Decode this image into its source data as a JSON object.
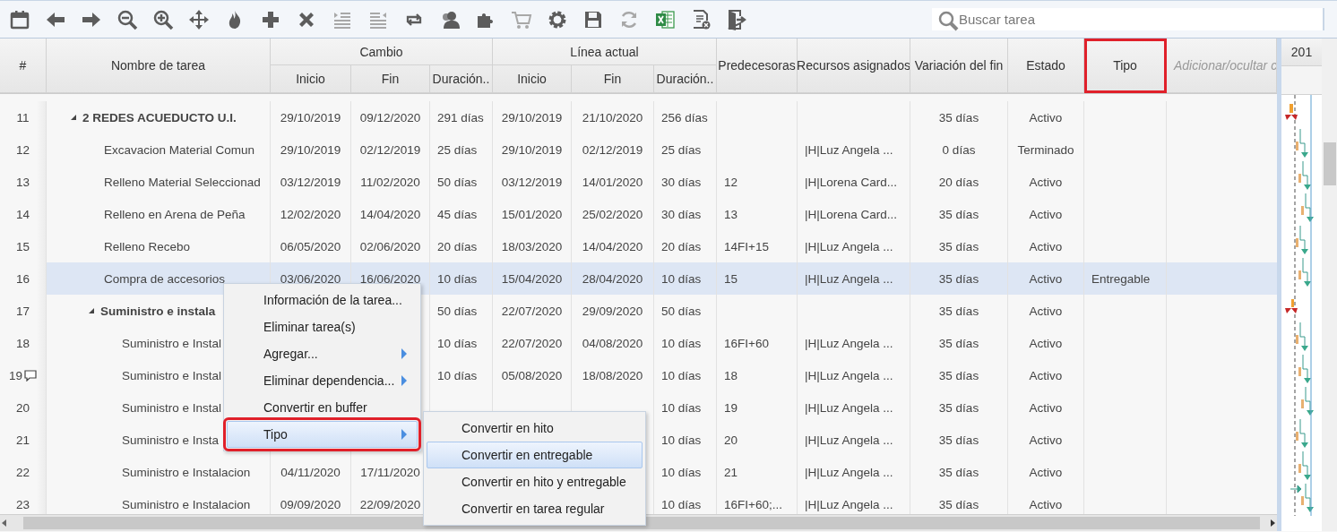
{
  "toolbar": {
    "buttons": [
      {
        "disabled": false
      },
      {
        "disabled": false
      },
      {
        "disabled": false
      },
      {
        "disabled": false
      },
      {
        "disabled": false
      },
      {
        "disabled": false
      },
      {
        "disabled": false
      },
      {
        "disabled": false
      },
      {
        "disabled": false
      },
      {
        "disabled": true
      },
      {
        "disabled": true
      },
      {
        "disabled": false
      },
      {
        "disabled": false
      },
      {
        "disabled": false
      },
      {
        "disabled": true
      },
      {
        "disabled": false
      },
      {
        "disabled": false
      },
      {
        "disabled": true
      },
      {
        "disabled": false
      },
      {
        "disabled": false
      },
      {
        "disabled": false
      }
    ],
    "search": {
      "placeholder": "Buscar tarea"
    }
  },
  "table": {
    "groups": [
      {
        "label": "Cambio"
      },
      {
        "label": "Línea actual"
      }
    ],
    "columns": [
      {
        "label": "#",
        "annotated": false
      },
      {
        "label": "Nombre de tarea",
        "annotated": false
      },
      {
        "label": "Inicio",
        "annotated": false
      },
      {
        "label": "Fin",
        "annotated": false
      },
      {
        "label": "Duración..",
        "annotated": false
      },
      {
        "label": "Inicio",
        "annotated": false
      },
      {
        "label": "Fin",
        "annotated": false
      },
      {
        "label": "Duración..",
        "annotated": false
      },
      {
        "label": "Predecesoras",
        "annotated": false
      },
      {
        "label": "Recursos asignados",
        "annotated": false
      },
      {
        "label": "Variación del fin",
        "annotated": false
      },
      {
        "label": "Estado",
        "annotated": false
      },
      {
        "label": "Tipo",
        "annotated": true
      },
      {
        "label": "Adicionar/ocultar c",
        "annotated": false
      }
    ],
    "rows": [
      {
        "n": "11",
        "name": "2 REDES ACUEDUCTO U.I.",
        "expanded": true,
        "selected": false,
        "comment": false,
        "c_inicio": "29/10/2019",
        "c_fin": "09/12/2020",
        "c_dur": "291 días",
        "l_inicio": "29/10/2019",
        "l_fin": "21/10/2020",
        "l_dur": "256 días",
        "variacion": "35 días",
        "estado": "Activo",
        "children": [
          {
            "n": "12",
            "name": "Excavacion Material Comun",
            "selected": false,
            "comment": false,
            "c_inicio": "29/10/2019",
            "c_fin": "02/12/2019",
            "c_dur": "25 días",
            "l_inicio": "29/10/2019",
            "l_fin": "02/12/2019",
            "l_dur": "25 días",
            "recursos": "|H|Luz Angela ...",
            "variacion": "0 días",
            "estado": "Terminado"
          },
          {
            "n": "13",
            "name": "Relleno Material Seleccionad",
            "selected": false,
            "comment": false,
            "c_inicio": "03/12/2019",
            "c_fin": "11/02/2020",
            "c_dur": "50 días",
            "l_inicio": "03/12/2019",
            "l_fin": "14/01/2020",
            "l_dur": "30 días",
            "pred": "12",
            "recursos": "|H|Lorena Card...",
            "variacion": "20 días",
            "estado": "Activo"
          },
          {
            "n": "14",
            "name": "Relleno en Arena de Peña",
            "selected": false,
            "comment": false,
            "c_inicio": "12/02/2020",
            "c_fin": "14/04/2020",
            "c_dur": "45 días",
            "l_inicio": "15/01/2020",
            "l_fin": "25/02/2020",
            "l_dur": "30 días",
            "pred": "13",
            "recursos": "|H|Lorena Card...",
            "variacion": "35 días",
            "estado": "Activo"
          },
          {
            "n": "15",
            "name": "Relleno Recebo",
            "selected": false,
            "comment": false,
            "c_inicio": "06/05/2020",
            "c_fin": "02/06/2020",
            "c_dur": "20 días",
            "l_inicio": "18/03/2020",
            "l_fin": "14/04/2020",
            "l_dur": "20 días",
            "pred": "14FI+15",
            "recursos": "|H|Luz Angela ...",
            "variacion": "35 días",
            "estado": "Activo"
          },
          {
            "n": "16",
            "name": "Compra de accesorios",
            "selected": true,
            "comment": false,
            "c_inicio": "03/06/2020",
            "c_fin": "16/06/2020",
            "c_dur": "10 días",
            "l_inicio": "15/04/2020",
            "l_fin": "28/04/2020",
            "l_dur": "10 días",
            "pred": "15",
            "recursos": "|H|Luz Angela ...",
            "variacion": "35 días",
            "estado": "Activo",
            "tipo": "Entregable"
          },
          {
            "n": "17",
            "name": "Suministro e instala",
            "expanded": true,
            "selected": false,
            "comment": false,
            "c_dur": "50 días",
            "l_inicio": "22/07/2020",
            "l_fin": "29/09/2020",
            "l_dur": "50 días",
            "variacion": "35 días",
            "estado": "Activo",
            "children": [
              {
                "n": "18",
                "name": "Suministro e Instal",
                "selected": false,
                "comment": false,
                "c_dur": "10 días",
                "l_inicio": "22/07/2020",
                "l_fin": "04/08/2020",
                "l_dur": "10 días",
                "pred": "16FI+60",
                "recursos": "|H|Luz Angela ...",
                "variacion": "35 días",
                "estado": "Activo"
              },
              {
                "n": "19",
                "name": "Suministro e Instal",
                "selected": false,
                "comment": true,
                "c_dur": "10 días",
                "l_inicio": "05/08/2020",
                "l_fin": "18/08/2020",
                "l_dur": "10 días",
                "pred": "18",
                "recursos": "|H|Luz Angela ...",
                "variacion": "35 días",
                "estado": "Activo"
              },
              {
                "n": "20",
                "name": "Suministro e Instal",
                "selected": false,
                "comment": false,
                "l_dur": "10 días",
                "pred": "19",
                "recursos": "|H|Luz Angela ...",
                "variacion": "35 días",
                "estado": "Activo"
              },
              {
                "n": "21",
                "name": "Suministro e Insta",
                "selected": false,
                "comment": false,
                "l_dur": "10 días",
                "pred": "20",
                "recursos": "|H|Luz Angela ...",
                "variacion": "35 días",
                "estado": "Activo"
              },
              {
                "n": "22",
                "name": "Suministro e Instalacion",
                "selected": false,
                "comment": false,
                "c_inicio": "04/11/2020",
                "c_fin": "17/11/2020",
                "l_dur": "10 días",
                "pred": "21",
                "recursos": "|H|Luz Angela ...",
                "variacion": "35 días",
                "estado": "Activo"
              },
              {
                "n": "23",
                "name": "Suministro e Instalacion",
                "selected": false,
                "comment": false,
                "c_inicio": "09/09/2020",
                "c_fin": "22/09/2020",
                "l_dur": "10 días",
                "pred": "16FI+60;...",
                "recursos": "|H|Luz Angela ...",
                "variacion": "35 días",
                "estado": "Activo"
              }
            ]
          }
        ]
      }
    ]
  },
  "gantt": {
    "year": "201"
  },
  "context_menu": {
    "items": [
      {
        "label": "Información de la tarea...",
        "submenu": false,
        "selected": false,
        "annotated": false
      },
      {
        "label": "Eliminar tarea(s)",
        "submenu": false,
        "selected": false,
        "annotated": false
      },
      {
        "label": "Agregar...",
        "submenu": true,
        "selected": false,
        "annotated": false
      },
      {
        "label": "Eliminar dependencia...",
        "submenu": true,
        "selected": false,
        "annotated": false
      },
      {
        "label": "Convertir en buffer",
        "submenu": false,
        "selected": false,
        "annotated": false
      },
      {
        "label": "Tipo",
        "submenu": true,
        "selected": true,
        "annotated": true
      }
    ],
    "submenu": [
      {
        "label": "Convertir en hito",
        "selected": false
      },
      {
        "label": "Convertir en entregable",
        "selected": true
      },
      {
        "label": "Convertir en hito y entregable",
        "selected": false
      },
      {
        "label": "Convertir en tarea regular",
        "selected": false
      }
    ]
  }
}
